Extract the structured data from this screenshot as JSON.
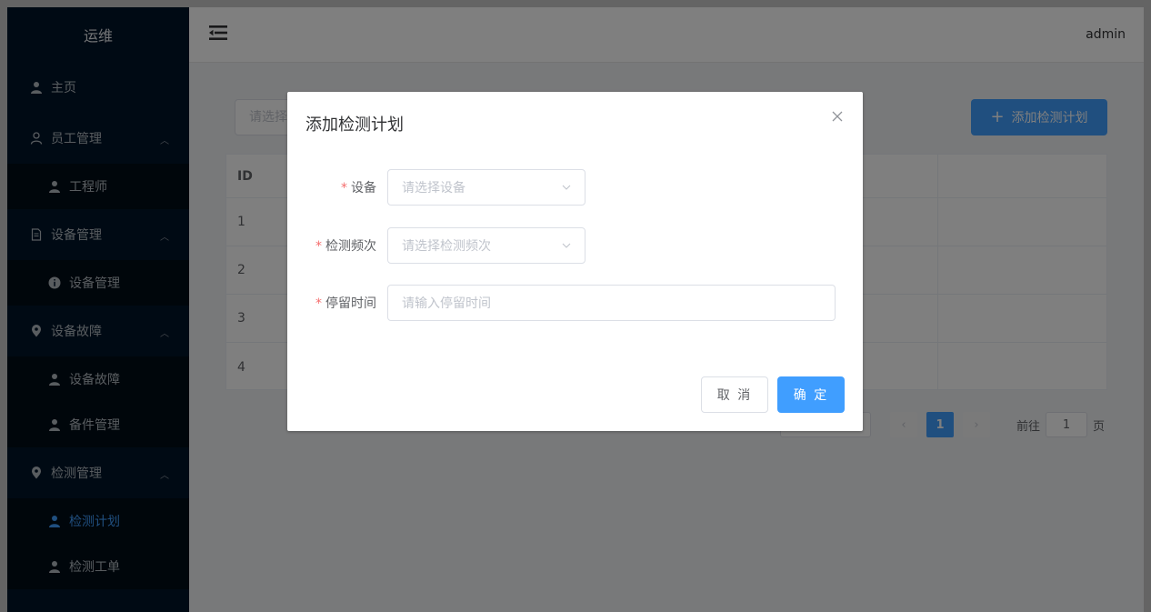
{
  "sidebar": {
    "brand": "运维",
    "items": [
      {
        "label": "主页",
        "icon": "user-icon"
      },
      {
        "label": "员工管理",
        "icon": "user-outline-icon",
        "expanded": true,
        "children": [
          {
            "label": "工程师",
            "icon": "user-icon"
          }
        ]
      },
      {
        "label": "设备管理",
        "icon": "document-icon",
        "expanded": true,
        "children": [
          {
            "label": "设备管理",
            "icon": "info-icon"
          }
        ]
      },
      {
        "label": "设备故障",
        "icon": "location-icon",
        "expanded": true,
        "children": [
          {
            "label": "设备故障",
            "icon": "user-icon"
          },
          {
            "label": "备件管理",
            "icon": "user-icon"
          }
        ]
      },
      {
        "label": "检测管理",
        "icon": "location-icon",
        "expanded": true,
        "children": [
          {
            "label": "检测计划",
            "icon": "user-icon",
            "active": true
          },
          {
            "label": "检测工单",
            "icon": "user-icon"
          }
        ]
      }
    ],
    "active_color": "#409eff"
  },
  "header": {
    "menu_toggle_icon": "menu-fold-icon",
    "user": "admin"
  },
  "main": {
    "search_placeholder": "请选择",
    "add_button": "添加检测计划",
    "table": {
      "header_id": "ID",
      "rows": [
        "1",
        "2",
        "3",
        "4"
      ]
    },
    "pagination": {
      "current_page": "1",
      "goto_prefix": "前往",
      "goto_value": "1",
      "goto_suffix": "页"
    }
  },
  "dialog": {
    "title": "添加检测计划",
    "fields": {
      "device": {
        "label": "设备",
        "placeholder": "请选择设备"
      },
      "frequency": {
        "label": "检测频次",
        "placeholder": "请选择检测频次"
      },
      "stay_time": {
        "label": "停留时间",
        "placeholder": "请输入停留时间"
      }
    },
    "cancel": "取 消",
    "confirm": "确 定"
  },
  "colors": {
    "primary": "#409eff",
    "sidebar_bg": "#001529",
    "required": "#f56c6c"
  }
}
